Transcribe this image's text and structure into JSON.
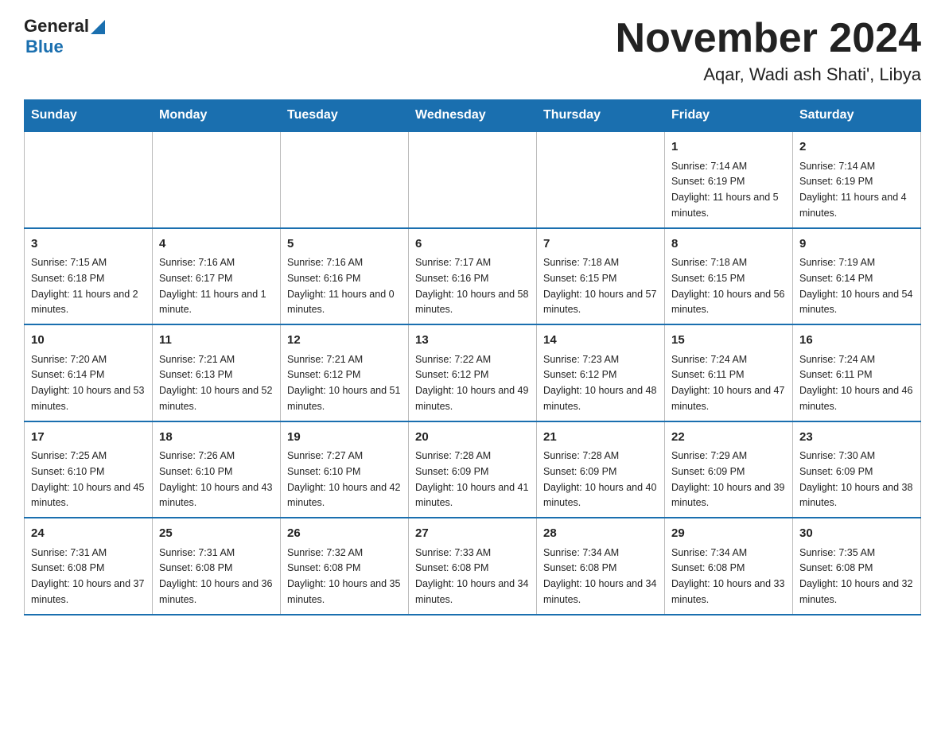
{
  "header": {
    "logo_line1": "General",
    "logo_line2": "Blue",
    "title": "November 2024",
    "subtitle": "Aqar, Wadi ash Shati', Libya"
  },
  "calendar": {
    "days_of_week": [
      "Sunday",
      "Monday",
      "Tuesday",
      "Wednesday",
      "Thursday",
      "Friday",
      "Saturday"
    ],
    "weeks": [
      [
        {
          "day": "",
          "info": ""
        },
        {
          "day": "",
          "info": ""
        },
        {
          "day": "",
          "info": ""
        },
        {
          "day": "",
          "info": ""
        },
        {
          "day": "",
          "info": ""
        },
        {
          "day": "1",
          "info": "Sunrise: 7:14 AM\nSunset: 6:19 PM\nDaylight: 11 hours and 5 minutes."
        },
        {
          "day": "2",
          "info": "Sunrise: 7:14 AM\nSunset: 6:19 PM\nDaylight: 11 hours and 4 minutes."
        }
      ],
      [
        {
          "day": "3",
          "info": "Sunrise: 7:15 AM\nSunset: 6:18 PM\nDaylight: 11 hours and 2 minutes."
        },
        {
          "day": "4",
          "info": "Sunrise: 7:16 AM\nSunset: 6:17 PM\nDaylight: 11 hours and 1 minute."
        },
        {
          "day": "5",
          "info": "Sunrise: 7:16 AM\nSunset: 6:16 PM\nDaylight: 11 hours and 0 minutes."
        },
        {
          "day": "6",
          "info": "Sunrise: 7:17 AM\nSunset: 6:16 PM\nDaylight: 10 hours and 58 minutes."
        },
        {
          "day": "7",
          "info": "Sunrise: 7:18 AM\nSunset: 6:15 PM\nDaylight: 10 hours and 57 minutes."
        },
        {
          "day": "8",
          "info": "Sunrise: 7:18 AM\nSunset: 6:15 PM\nDaylight: 10 hours and 56 minutes."
        },
        {
          "day": "9",
          "info": "Sunrise: 7:19 AM\nSunset: 6:14 PM\nDaylight: 10 hours and 54 minutes."
        }
      ],
      [
        {
          "day": "10",
          "info": "Sunrise: 7:20 AM\nSunset: 6:14 PM\nDaylight: 10 hours and 53 minutes."
        },
        {
          "day": "11",
          "info": "Sunrise: 7:21 AM\nSunset: 6:13 PM\nDaylight: 10 hours and 52 minutes."
        },
        {
          "day": "12",
          "info": "Sunrise: 7:21 AM\nSunset: 6:12 PM\nDaylight: 10 hours and 51 minutes."
        },
        {
          "day": "13",
          "info": "Sunrise: 7:22 AM\nSunset: 6:12 PM\nDaylight: 10 hours and 49 minutes."
        },
        {
          "day": "14",
          "info": "Sunrise: 7:23 AM\nSunset: 6:12 PM\nDaylight: 10 hours and 48 minutes."
        },
        {
          "day": "15",
          "info": "Sunrise: 7:24 AM\nSunset: 6:11 PM\nDaylight: 10 hours and 47 minutes."
        },
        {
          "day": "16",
          "info": "Sunrise: 7:24 AM\nSunset: 6:11 PM\nDaylight: 10 hours and 46 minutes."
        }
      ],
      [
        {
          "day": "17",
          "info": "Sunrise: 7:25 AM\nSunset: 6:10 PM\nDaylight: 10 hours and 45 minutes."
        },
        {
          "day": "18",
          "info": "Sunrise: 7:26 AM\nSunset: 6:10 PM\nDaylight: 10 hours and 43 minutes."
        },
        {
          "day": "19",
          "info": "Sunrise: 7:27 AM\nSunset: 6:10 PM\nDaylight: 10 hours and 42 minutes."
        },
        {
          "day": "20",
          "info": "Sunrise: 7:28 AM\nSunset: 6:09 PM\nDaylight: 10 hours and 41 minutes."
        },
        {
          "day": "21",
          "info": "Sunrise: 7:28 AM\nSunset: 6:09 PM\nDaylight: 10 hours and 40 minutes."
        },
        {
          "day": "22",
          "info": "Sunrise: 7:29 AM\nSunset: 6:09 PM\nDaylight: 10 hours and 39 minutes."
        },
        {
          "day": "23",
          "info": "Sunrise: 7:30 AM\nSunset: 6:09 PM\nDaylight: 10 hours and 38 minutes."
        }
      ],
      [
        {
          "day": "24",
          "info": "Sunrise: 7:31 AM\nSunset: 6:08 PM\nDaylight: 10 hours and 37 minutes."
        },
        {
          "day": "25",
          "info": "Sunrise: 7:31 AM\nSunset: 6:08 PM\nDaylight: 10 hours and 36 minutes."
        },
        {
          "day": "26",
          "info": "Sunrise: 7:32 AM\nSunset: 6:08 PM\nDaylight: 10 hours and 35 minutes."
        },
        {
          "day": "27",
          "info": "Sunrise: 7:33 AM\nSunset: 6:08 PM\nDaylight: 10 hours and 34 minutes."
        },
        {
          "day": "28",
          "info": "Sunrise: 7:34 AM\nSunset: 6:08 PM\nDaylight: 10 hours and 34 minutes."
        },
        {
          "day": "29",
          "info": "Sunrise: 7:34 AM\nSunset: 6:08 PM\nDaylight: 10 hours and 33 minutes."
        },
        {
          "day": "30",
          "info": "Sunrise: 7:35 AM\nSunset: 6:08 PM\nDaylight: 10 hours and 32 minutes."
        }
      ]
    ]
  }
}
